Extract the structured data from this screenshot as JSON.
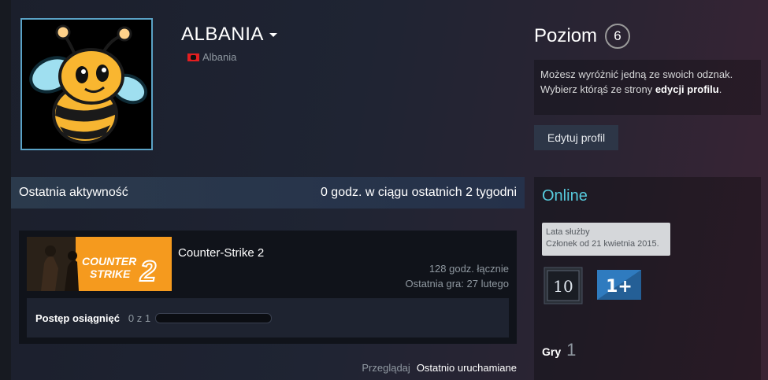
{
  "profile": {
    "name": "ALBANIA",
    "country": "Albania"
  },
  "level": {
    "label": "Poziom",
    "value": "6"
  },
  "badge_hint": {
    "text1": "Możesz wyróżnić jedną ze swoich odznak. Wybierz którąś ze strony ",
    "link": "edycji profilu",
    "text2": "."
  },
  "edit_profile_label": "Edytuj profil",
  "activity": {
    "title": "Ostatnia aktywność",
    "summary": "0 godz. w ciągu ostatnich 2 tygodni",
    "game": {
      "capsule_line1": "COUNTER",
      "capsule_line2": "STRIKE",
      "capsule_number": "2",
      "name": "Counter-Strike 2",
      "hours": "128 godz. łącznie",
      "last_played": "Ostatnia gra: 27 lutego",
      "achievements_label": "Postęp osiągnięć",
      "achievements_count": "0 z 1",
      "achievements_progress": 0
    },
    "browse_label": "Przeglądaj",
    "recent_label": "Ostatnio uruchamiane"
  },
  "sidebar": {
    "status": "Online",
    "service_title": "Lata służby",
    "service_since": "Członek od 21 kwietnia 2015.",
    "years_badge_value": "10",
    "plus_badge_value": "1+",
    "games_label": "Gry",
    "games_count": "1"
  },
  "colors": {
    "online": "#57cbde",
    "capsule_orange": "#f59a1e",
    "avatar_border": "#5aa2c6"
  }
}
